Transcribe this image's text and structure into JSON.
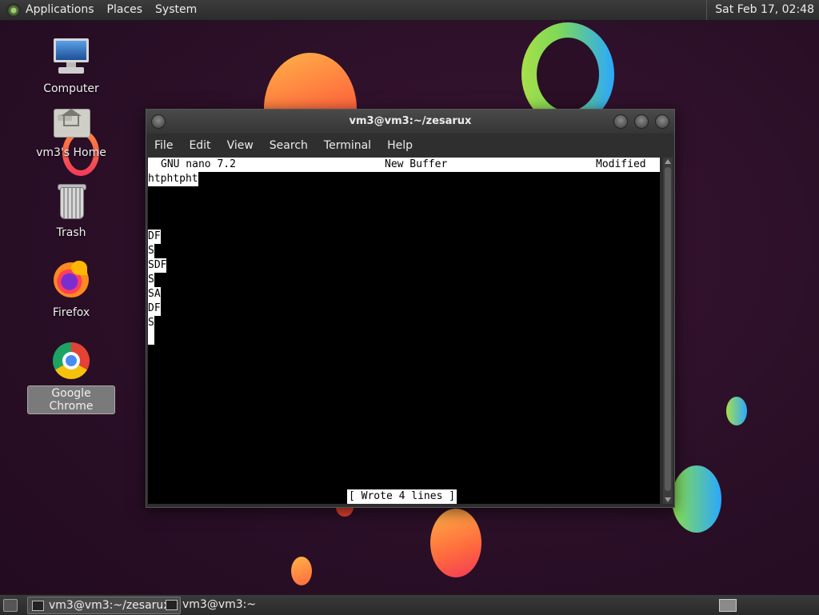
{
  "top_panel": {
    "menus": [
      "Applications",
      "Places",
      "System"
    ],
    "clock": "Sat Feb 17, 02:48"
  },
  "desktop_icons": [
    {
      "label": "Computer",
      "icon": "computer-icon"
    },
    {
      "label": "vm3's Home",
      "icon": "home-folder-icon"
    },
    {
      "label": "Trash",
      "icon": "trash-icon"
    },
    {
      "label": "Firefox",
      "icon": "firefox-icon"
    },
    {
      "label": "Google Chrome",
      "icon": "chrome-icon",
      "selected": true
    }
  ],
  "terminal": {
    "title": "vm3@vm3:~/zesarux",
    "menu": [
      "File",
      "Edit",
      "View",
      "Search",
      "Terminal",
      "Help"
    ],
    "nano": {
      "version": "GNU nano 7.2",
      "buffer_name": "New Buffer",
      "state": "Modified",
      "lines": [
        "htphtpht",
        "",
        "",
        "",
        "DF",
        "S",
        "SDF",
        "S",
        "SA",
        "DF",
        "S",
        " "
      ],
      "status": "[ Wrote 4 lines ]"
    }
  },
  "taskbar": {
    "tasks": [
      {
        "label": "vm3@vm3:~/zesarux",
        "active": true
      },
      {
        "label": "vm3@vm3:~",
        "active": false
      }
    ]
  }
}
